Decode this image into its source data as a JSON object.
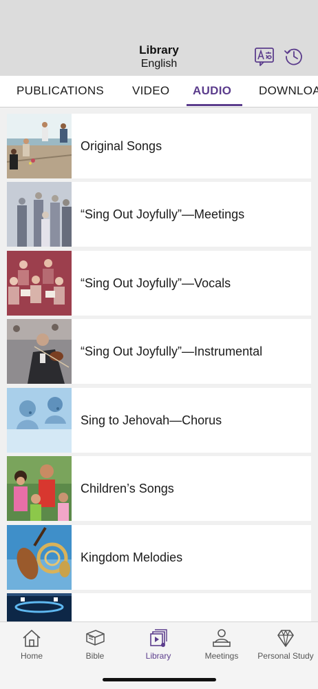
{
  "header": {
    "title": "Library",
    "subtitle": "English",
    "language_icon": "language-icon",
    "history_icon": "history-icon",
    "accent": "#5b3c8c"
  },
  "tabs": [
    {
      "label": "PUBLICATIONS",
      "active": false
    },
    {
      "label": "VIDEO",
      "active": false
    },
    {
      "label": "AUDIO",
      "active": true
    },
    {
      "label": "DOWNLOADS",
      "active": false
    }
  ],
  "items": [
    {
      "label": "Original Songs",
      "thumb": "photo-family-singing-deck"
    },
    {
      "label": "“Sing Out Joyfully”—Meetings",
      "thumb": "photo-congregation-singing"
    },
    {
      "label": "“Sing Out Joyfully”—Vocals",
      "thumb": "photo-choir-red"
    },
    {
      "label": "“Sing Out Joyfully”—Instrumental",
      "thumb": "photo-orchestra-violin"
    },
    {
      "label": "Sing to Jehovah—Chorus",
      "thumb": "photo-singers-blue"
    },
    {
      "label": "Children’s Songs",
      "thumb": "photo-children-singing"
    },
    {
      "label": "Kingdom Melodies",
      "thumb": "photo-violin-horn"
    },
    {
      "label": "",
      "thumb": "photo-stage-blue"
    }
  ],
  "bottom_nav": [
    {
      "label": "Home",
      "icon": "home-icon",
      "active": false
    },
    {
      "label": "Bible",
      "icon": "bible-icon",
      "active": false
    },
    {
      "label": "Library",
      "icon": "library-icon",
      "active": true
    },
    {
      "label": "Meetings",
      "icon": "meetings-icon",
      "active": false
    },
    {
      "label": "Personal Study",
      "icon": "personal-study-icon",
      "active": false
    }
  ]
}
